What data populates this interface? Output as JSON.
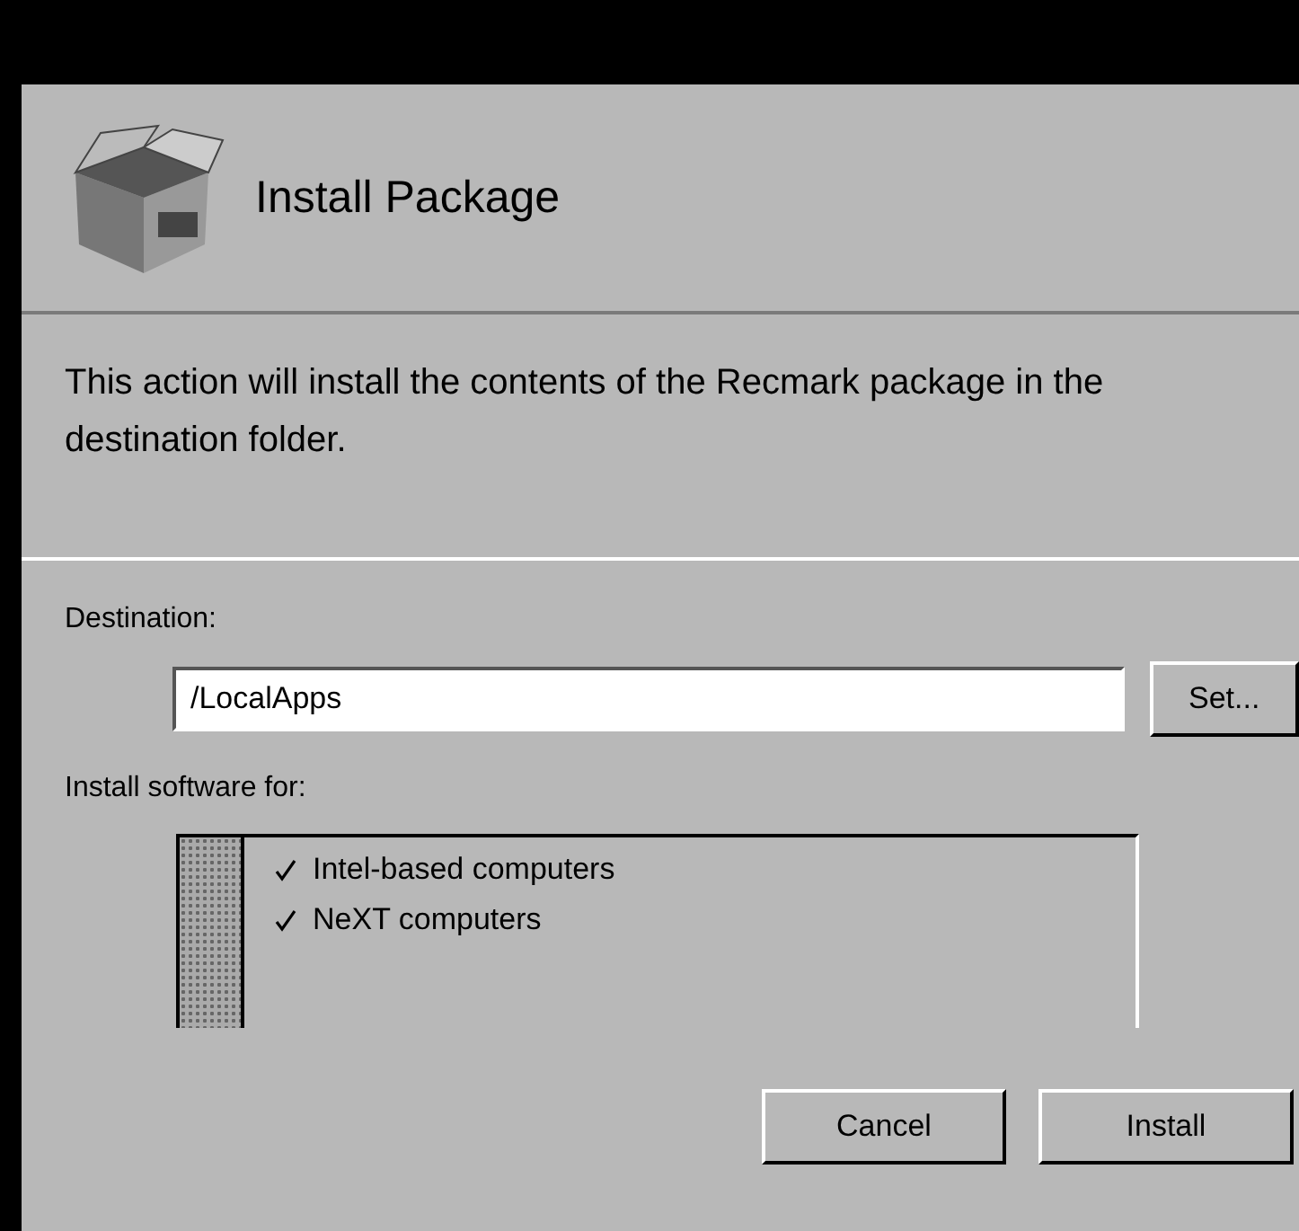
{
  "header": {
    "title": "Install Package"
  },
  "description": "This action will install the contents of the Recmark package in the destination folder.",
  "destination": {
    "label": "Destination:",
    "value": "/LocalApps",
    "button": "Set..."
  },
  "architectures": {
    "label": "Install software for:",
    "items": [
      {
        "label": "Intel-based computers",
        "checked": true
      },
      {
        "label": "NeXT computers",
        "checked": true
      }
    ]
  },
  "buttons": [
    "Cancel",
    "Install"
  ]
}
